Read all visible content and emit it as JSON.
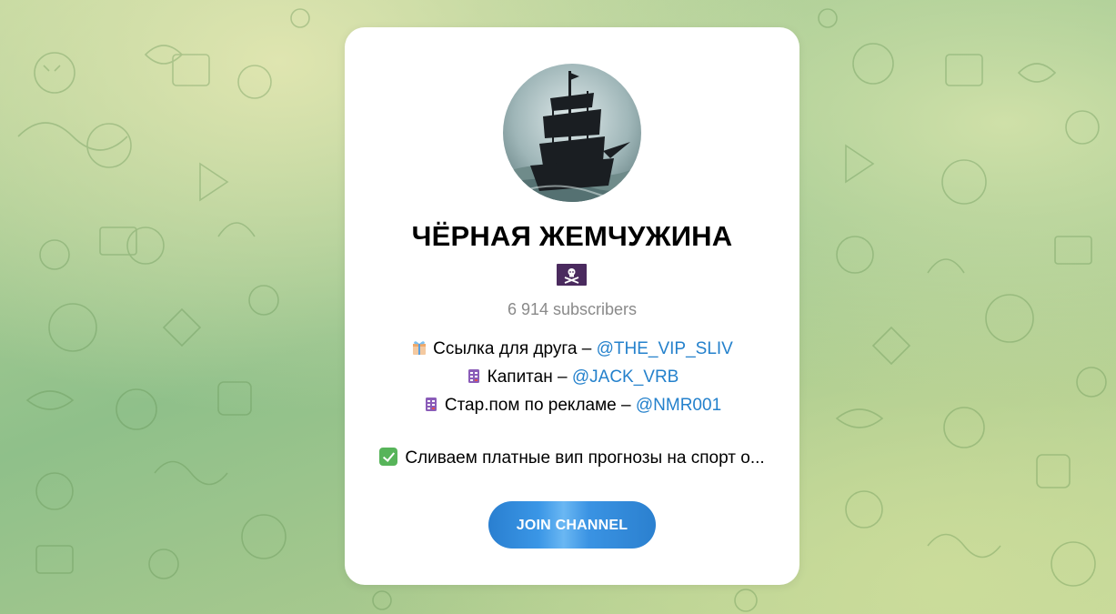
{
  "channel": {
    "title": "ЧЁРНАЯ ЖЕМЧУЖИНА",
    "flag_icon": "pirate-flag-icon",
    "subscribers": "6 914 subscribers",
    "description": [
      {
        "icon": "gift-icon",
        "text": "Ссылка для друга – ",
        "link": "@THE_VIP_SLIV"
      },
      {
        "icon": "calendar-icon",
        "text": "Капитан – ",
        "link": "@JACK_VRB"
      },
      {
        "icon": "calendar-icon",
        "text": "Стар.пом по рекламе – ",
        "link": "@NMR001"
      }
    ],
    "promo": {
      "icon": "check-mark-icon",
      "text": "Сливаем платные вип прогнозы на спорт о..."
    },
    "join_label": "JOIN CHANNEL"
  },
  "colors": {
    "link": "#2481cc",
    "button": "#2a7fd0",
    "background": "#8fc08a"
  }
}
